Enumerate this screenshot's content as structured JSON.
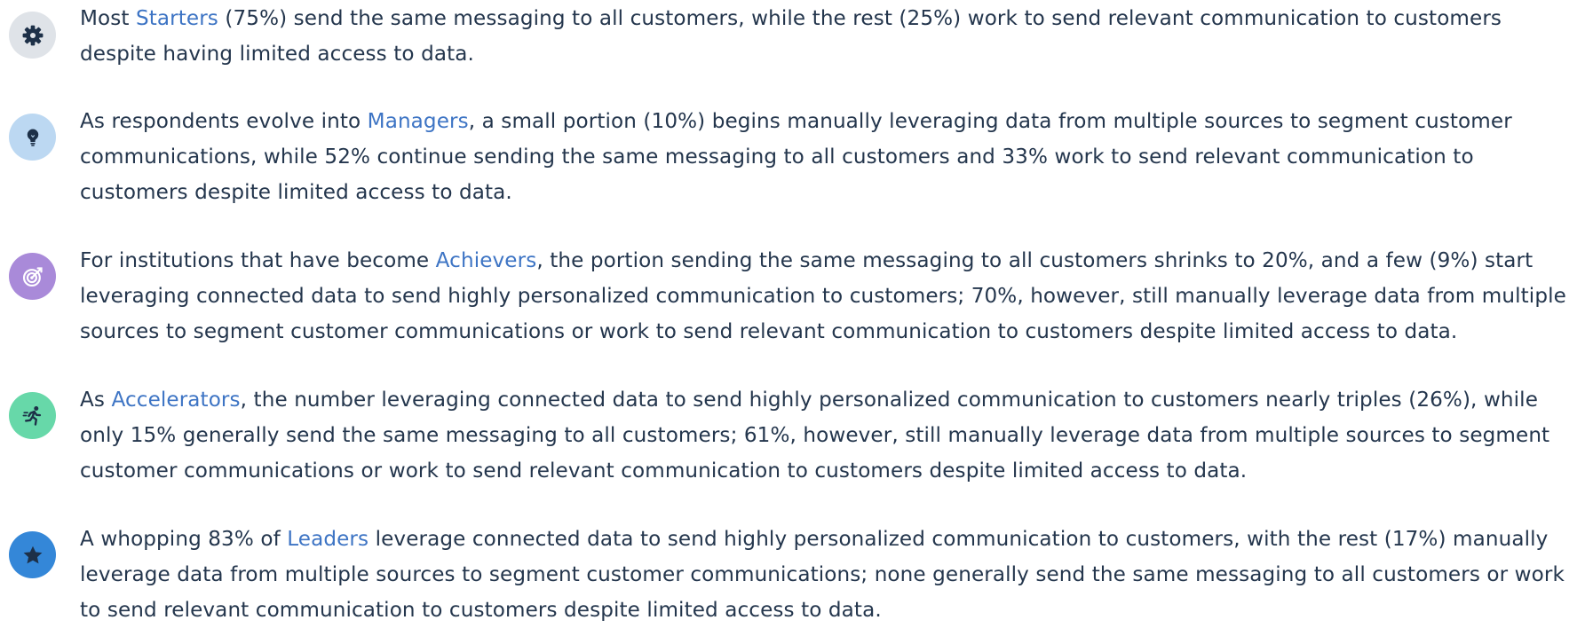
{
  "colors": {
    "text": "#24364d",
    "link": "#3d74c4"
  },
  "items": [
    {
      "icon": "gear-icon",
      "icon_bg": "#dfe3e8",
      "icon_fg": "#1d3048",
      "before": "Most ",
      "segment": "Starters",
      "after": " (75%) send the same messaging to all customers, while the rest (25%) work to send relevant communication to customers despite having limited access to data."
    },
    {
      "icon": "lightbulb-icon",
      "icon_bg": "#bcd8f2",
      "icon_fg": "#1d3048",
      "before": "As respondents evolve into ",
      "segment": "Managers",
      "after": ", a small portion (10%) begins manually leveraging data from multiple sources to segment customer communications, while 52% continue sending the same messaging to all customers and 33% work to send relevant communication to customers despite limited access to data."
    },
    {
      "icon": "target-icon",
      "icon_bg": "#a98ad9",
      "icon_fg": "#ffffff",
      "before": "For institutions that have become ",
      "segment": "Achievers",
      "after": ", the portion sending the same messaging to all customers shrinks to 20%, and a few (9%) start leveraging connected data to send highly personalized communication to customers; 70%, however, still manually leverage data from multiple sources to segment customer communications or work to send relevant communication to customers despite limited access to data."
    },
    {
      "icon": "runner-icon",
      "icon_bg": "#67d8a9",
      "icon_fg": "#1d3048",
      "before": "As ",
      "segment": "Accelerators",
      "after": ", the number leveraging connected data to send highly personalized communication to customers nearly triples (26%), while only 15% generally send the same messaging to all customers; 61%, however, still manually leverage data from multiple sources to segment customer communications or work to send relevant communication to customers despite limited access to data."
    },
    {
      "icon": "star-icon",
      "icon_bg": "#3487d8",
      "icon_fg": "#1d3048",
      "before": "A whopping 83% of ",
      "segment": "Leaders",
      "after": " leverage connected data to send highly personalized communication to customers, with the rest (17%) manually leverage data from multiple sources to segment customer communications; none generally send the same messaging to all customers or work to send relevant communication to customers despite limited access to data."
    }
  ]
}
